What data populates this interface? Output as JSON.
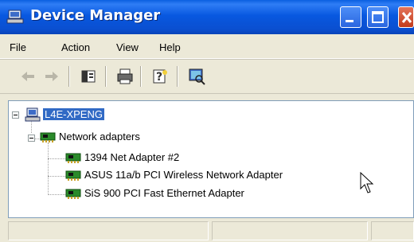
{
  "window": {
    "title": "Device Manager"
  },
  "menu": {
    "items": [
      "File",
      "Action",
      "View",
      "Help"
    ]
  },
  "toolbar": {
    "buttons": [
      "back-icon",
      "forward-icon",
      "properties-icon",
      "print-icon",
      "help-icon",
      "scan-hardware-icon"
    ]
  },
  "tree": {
    "computer": {
      "label": "L4E-XPENG",
      "expanded": true,
      "selected": true
    },
    "category": {
      "label": "Network adapters",
      "expanded": true
    },
    "devices": [
      {
        "label": "1394 Net Adapter #2"
      },
      {
        "label": "ASUS 11a/b PCI Wireless Network Adapter"
      },
      {
        "label": "SiS 900 PCI Fast Ethernet Adapter"
      }
    ]
  },
  "colors": {
    "titlebar": "#0a5fe0",
    "selection": "#316ac5",
    "chrome": "#ece9d8"
  }
}
